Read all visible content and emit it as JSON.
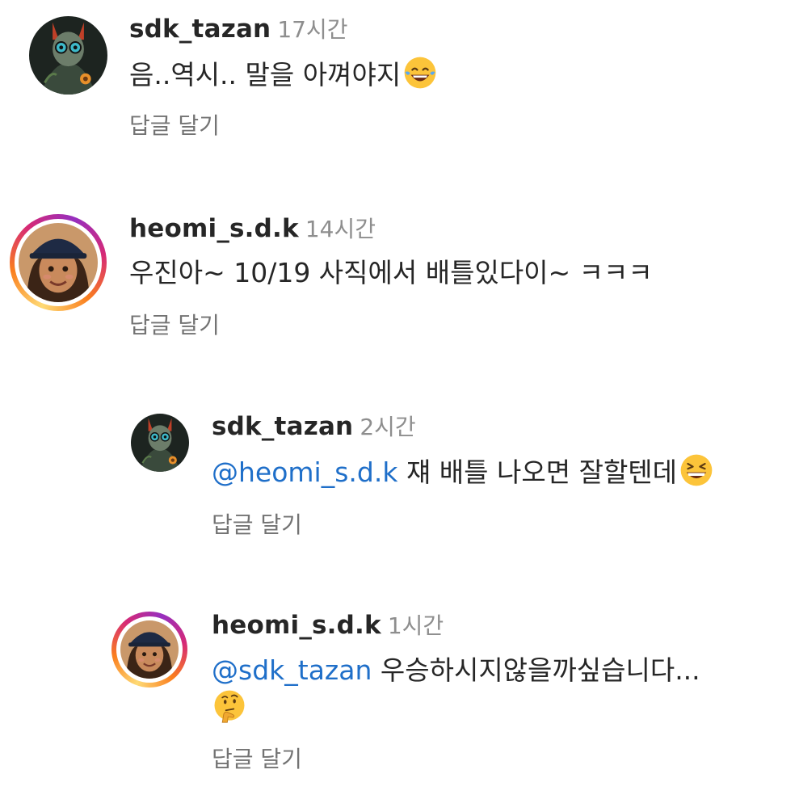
{
  "comments": [
    {
      "username": "sdk_tazan",
      "time": "17시간",
      "mention": "",
      "text": "음..역시.. 말을 아껴야지",
      "emoji": "face-with-tears-of-joy-icon",
      "reply_label": "답글 달기"
    },
    {
      "username": "heomi_s.d.k",
      "time": "14시간",
      "mention": "",
      "text": "우진아~ 10/19 사직에서 배틀있다이~ ㅋㅋㅋ",
      "emoji": "",
      "reply_label": "답글 달기"
    },
    {
      "username": "sdk_tazan",
      "time": "2시간",
      "mention": "@heomi_s.d.k",
      "text": "쟤 배틀 나오면 잘할텐데",
      "emoji": "grinning-squinting-face-icon",
      "reply_label": "답글 달기"
    },
    {
      "username": "heomi_s.d.k",
      "time": "1시간",
      "mention": "@sdk_tazan",
      "text": "우승하시지않을까싶습니다...",
      "emoji": "thinking-face-icon",
      "reply_label": "답글 달기"
    }
  ],
  "colors": {
    "mention": "#1f6fc9",
    "meta": "#8e8e8e",
    "text": "#262626",
    "story_ring": [
      "#feda75",
      "#fa7e1e",
      "#d62976",
      "#962fbf"
    ]
  }
}
